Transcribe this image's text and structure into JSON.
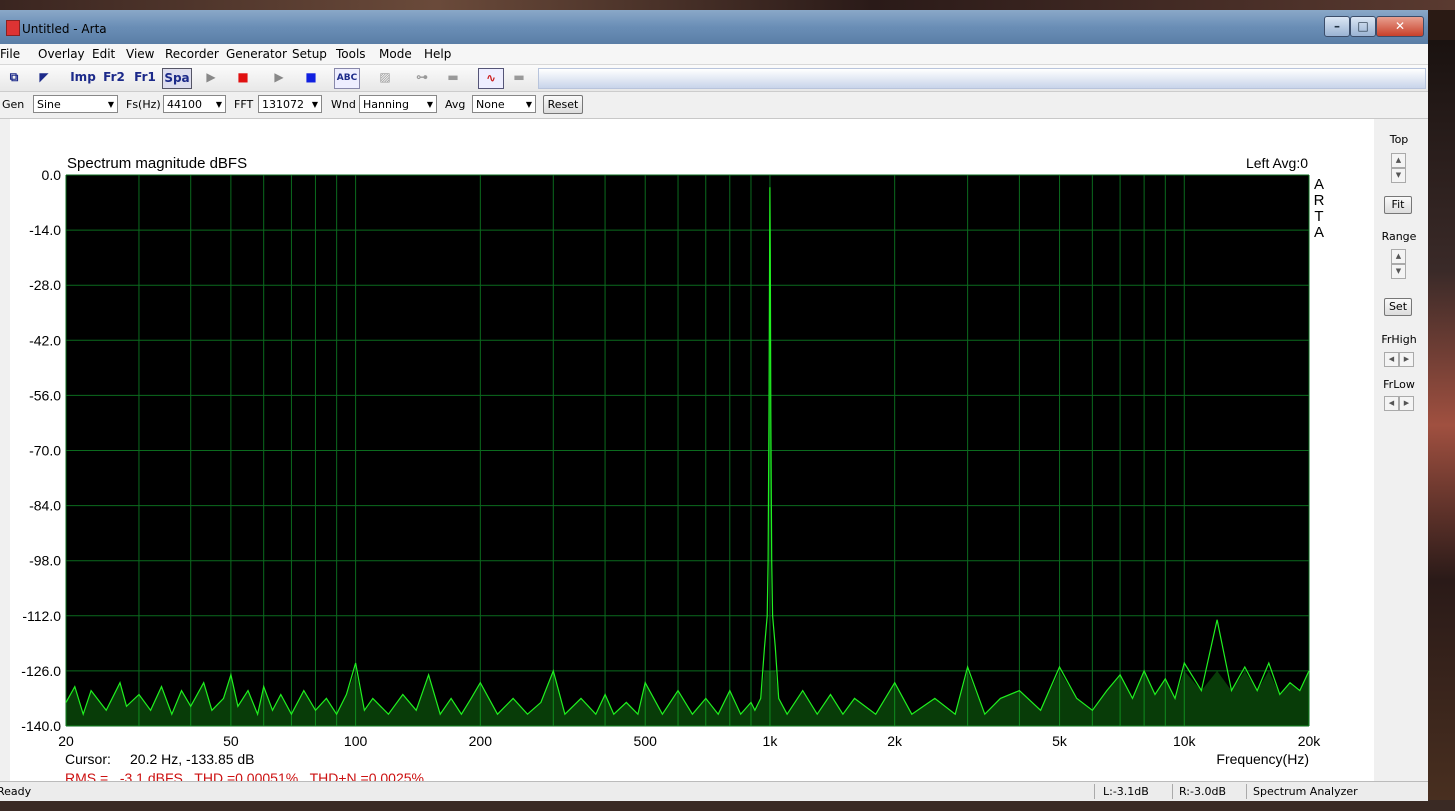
{
  "window": {
    "title": "Untitled - Arta"
  },
  "menu": [
    "File",
    "Overlay",
    "Edit",
    "View",
    "Recorder",
    "Generator",
    "Setup",
    "Tools",
    "Mode",
    "Help"
  ],
  "toolbar": {
    "imp_label": "Imp",
    "fr2_label": "Fr2",
    "fr1_label": "Fr1",
    "spa_label": "Spa"
  },
  "params": {
    "gen_label": "Gen",
    "gen_value": "Sine",
    "fs_label": "Fs(Hz)",
    "fs_value": "44100",
    "fft_label": "FFT",
    "fft_value": "131072",
    "wnd_label": "Wnd",
    "wnd_value": "Hanning",
    "avg_label": "Avg",
    "avg_value": "None",
    "reset_label": "Reset"
  },
  "side_panel": {
    "top_label": "Top",
    "fit_label": "Fit",
    "range_label": "Range",
    "set_label": "Set",
    "frhigh_label": "FrHigh",
    "frlow_label": "FrLow"
  },
  "plot_info": {
    "channel_avg": "Left  Avg:0",
    "brand": [
      "A",
      "R",
      "T",
      "A"
    ],
    "cursor_label": "Cursor:",
    "cursor_value": "20.2 Hz, -133.85 dB",
    "measure": "RMS =   -3.1 dBFS   THD =0.00051%   THD+N =0.0025%"
  },
  "status": {
    "ready": "Ready",
    "left_level": "L:-3.1dB",
    "right_level": "R:-3.0dB",
    "mode": "Spectrum Analyzer"
  },
  "colors": {
    "plot_bg": "#000000",
    "grid": "#0b6b1e",
    "trace": "#20f020",
    "measure_text": "#cc1111"
  },
  "chart_data": {
    "type": "line",
    "title": "Spectrum magnitude dBFS",
    "xlabel": "Frequency(Hz)",
    "ylabel": "",
    "x_scale": "log",
    "xlim": [
      20,
      20000
    ],
    "ylim": [
      -140,
      0
    ],
    "grid": true,
    "x_ticks": [
      {
        "v": 20,
        "label": "20"
      },
      {
        "v": 50,
        "label": "50"
      },
      {
        "v": 100,
        "label": "100"
      },
      {
        "v": 200,
        "label": "200"
      },
      {
        "v": 500,
        "label": "500"
      },
      {
        "v": 1000,
        "label": "1k"
      },
      {
        "v": 2000,
        "label": "2k"
      },
      {
        "v": 5000,
        "label": "5k"
      },
      {
        "v": 10000,
        "label": "10k"
      },
      {
        "v": 20000,
        "label": "20k"
      }
    ],
    "y_ticks": [
      {
        "v": 0,
        "label": "0.0"
      },
      {
        "v": -14,
        "label": "-14.0"
      },
      {
        "v": -28,
        "label": "-28.0"
      },
      {
        "v": -42,
        "label": "-42.0"
      },
      {
        "v": -56,
        "label": "-56.0"
      },
      {
        "v": -70,
        "label": "-70.0"
      },
      {
        "v": -84,
        "label": "-84.0"
      },
      {
        "v": -98,
        "label": "-98.0"
      },
      {
        "v": -112,
        "label": "-112.0"
      },
      {
        "v": -126,
        "label": "-126.0"
      },
      {
        "v": -140,
        "label": "-140.0"
      }
    ],
    "series": [
      {
        "values": [
          [
            20,
            -134
          ],
          [
            21,
            -130
          ],
          [
            22,
            -137
          ],
          [
            23,
            -131
          ],
          [
            25,
            -136
          ],
          [
            27,
            -129
          ],
          [
            28,
            -135
          ],
          [
            30,
            -132
          ],
          [
            32,
            -136
          ],
          [
            34,
            -130
          ],
          [
            36,
            -137
          ],
          [
            38,
            -131
          ],
          [
            40,
            -135
          ],
          [
            43,
            -129
          ],
          [
            45,
            -136
          ],
          [
            48,
            -133
          ],
          [
            50,
            -127
          ],
          [
            52,
            -135
          ],
          [
            55,
            -131
          ],
          [
            58,
            -137
          ],
          [
            60,
            -130
          ],
          [
            63,
            -136
          ],
          [
            66,
            -132
          ],
          [
            70,
            -137
          ],
          [
            75,
            -131
          ],
          [
            80,
            -136
          ],
          [
            85,
            -133
          ],
          [
            90,
            -137
          ],
          [
            95,
            -132
          ],
          [
            100,
            -124
          ],
          [
            105,
            -136
          ],
          [
            110,
            -133
          ],
          [
            120,
            -137
          ],
          [
            130,
            -132
          ],
          [
            140,
            -136
          ],
          [
            150,
            -127
          ],
          [
            160,
            -137
          ],
          [
            170,
            -133
          ],
          [
            180,
            -137
          ],
          [
            190,
            -133
          ],
          [
            200,
            -129
          ],
          [
            220,
            -137
          ],
          [
            240,
            -133
          ],
          [
            260,
            -137
          ],
          [
            280,
            -134
          ],
          [
            300,
            -126
          ],
          [
            320,
            -137
          ],
          [
            350,
            -133
          ],
          [
            380,
            -137
          ],
          [
            400,
            -132
          ],
          [
            420,
            -137
          ],
          [
            450,
            -134
          ],
          [
            480,
            -137
          ],
          [
            500,
            -129
          ],
          [
            550,
            -137
          ],
          [
            600,
            -131
          ],
          [
            650,
            -137
          ],
          [
            700,
            -133
          ],
          [
            750,
            -137
          ],
          [
            800,
            -131
          ],
          [
            850,
            -137
          ],
          [
            900,
            -134
          ],
          [
            920,
            -136
          ],
          [
            950,
            -133
          ],
          [
            970,
            -120
          ],
          [
            985,
            -112
          ],
          [
            990,
            -98
          ],
          [
            995,
            -60
          ],
          [
            998,
            -20
          ],
          [
            1000,
            -3.1
          ],
          [
            1002,
            -20
          ],
          [
            1005,
            -60
          ],
          [
            1010,
            -98
          ],
          [
            1015,
            -112
          ],
          [
            1030,
            -120
          ],
          [
            1050,
            -133
          ],
          [
            1100,
            -137
          ],
          [
            1200,
            -131
          ],
          [
            1300,
            -137
          ],
          [
            1400,
            -132
          ],
          [
            1500,
            -137
          ],
          [
            1600,
            -133
          ],
          [
            1800,
            -137
          ],
          [
            2000,
            -129
          ],
          [
            2200,
            -137
          ],
          [
            2500,
            -133
          ],
          [
            2800,
            -137
          ],
          [
            3000,
            -125
          ],
          [
            3300,
            -137
          ],
          [
            3600,
            -133
          ],
          [
            4000,
            -131
          ],
          [
            4500,
            -136
          ],
          [
            5000,
            -125
          ],
          [
            5500,
            -133
          ],
          [
            6000,
            -136
          ],
          [
            6500,
            -131
          ],
          [
            7000,
            -127
          ],
          [
            7500,
            -133
          ],
          [
            8000,
            -126
          ],
          [
            8500,
            -132
          ],
          [
            9000,
            -128
          ],
          [
            9500,
            -133
          ],
          [
            10000,
            -124
          ],
          [
            11000,
            -131
          ],
          [
            12000,
            -113
          ],
          [
            13000,
            -131
          ],
          [
            14000,
            -125
          ],
          [
            15000,
            -131
          ],
          [
            16000,
            -124
          ],
          [
            17000,
            -132
          ],
          [
            18000,
            -129
          ],
          [
            19000,
            -131
          ],
          [
            20000,
            -126
          ]
        ]
      }
    ]
  }
}
